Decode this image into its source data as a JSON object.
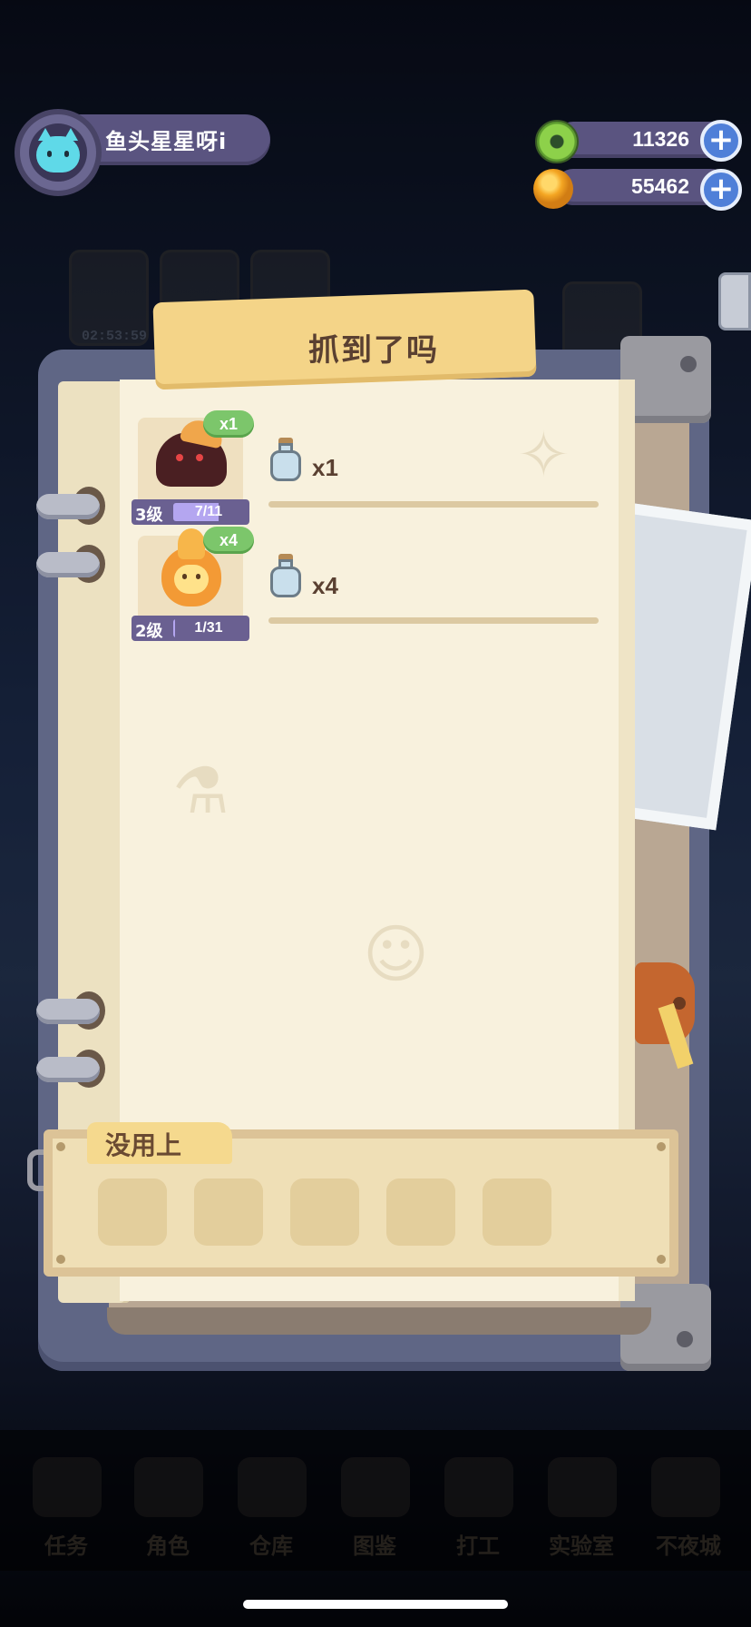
{
  "player": {
    "name": "鱼头星星呀i"
  },
  "currencies": [
    {
      "name": "donut-currency",
      "value": "11326"
    },
    {
      "name": "planet-currency",
      "value": "55462"
    }
  ],
  "background": {
    "timer": "02:53:59",
    "nav": [
      "任务",
      "角色",
      "仓库",
      "图鉴",
      "打工",
      "实验室",
      "不夜城"
    ]
  },
  "panel": {
    "title": "抓到了吗",
    "caught": [
      {
        "count": "x1",
        "level": "3级",
        "progress": "7/11",
        "progress_fraction": 0.636,
        "drop_qty": "x1"
      },
      {
        "count": "x4",
        "level": "2级",
        "progress": "1/31",
        "progress_fraction": 0.032,
        "drop_qty": "x4"
      }
    ],
    "unused_label": "没用上",
    "unused_slot_count": 5
  },
  "colors": {
    "badge_green": "#7cc66b",
    "level_bar": "#6a6091",
    "plus_button": "#4f7fd8"
  }
}
